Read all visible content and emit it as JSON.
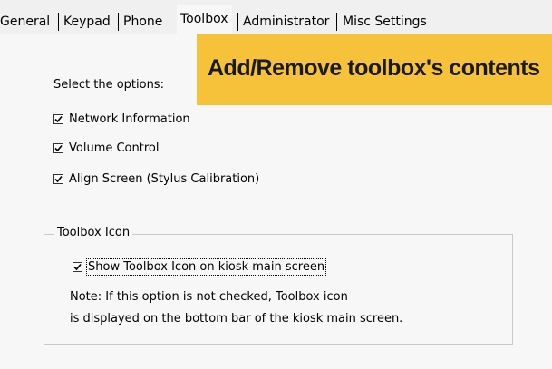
{
  "tabs": [
    {
      "label": "General"
    },
    {
      "label": "Keypad"
    },
    {
      "label": "Phone"
    },
    {
      "label": "Toolbox",
      "active": true
    },
    {
      "label": "Administrator"
    },
    {
      "label": "Misc Settings"
    }
  ],
  "banner": {
    "text": "Add/Remove toolbox's contents",
    "color": "#f6c23a"
  },
  "options": {
    "prompt": "Select the options:",
    "items": [
      {
        "label": "Network Information",
        "checked": true
      },
      {
        "label": "Volume Control",
        "checked": true
      },
      {
        "label": "Align Screen (Stylus Calibration)",
        "checked": true
      }
    ]
  },
  "toolbox_icon": {
    "group_title": "Toolbox Icon",
    "checkbox_label": "Show Toolbox Icon on kiosk main screen",
    "checked": true,
    "note_line1": "Note: If this option is not checked, Toolbox icon",
    "note_line2": "is displayed on the bottom bar of the kiosk main screen."
  }
}
